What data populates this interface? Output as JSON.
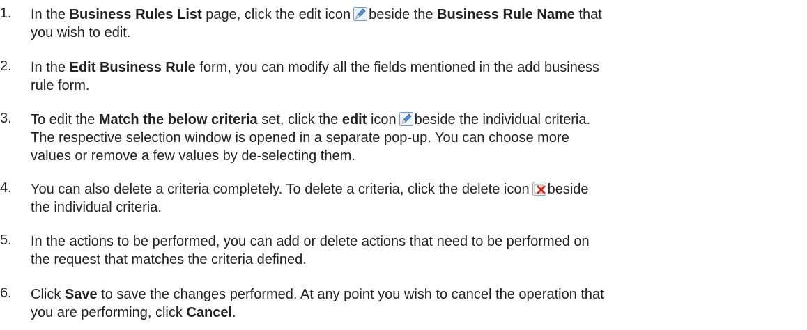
{
  "steps": [
    {
      "number": "1.",
      "l1_a": "In the ",
      "l1_b": "Business Rules List",
      "l1_c": " page, click the edit icon",
      "l1_d": "beside the ",
      "l1_e": "Business Rule Name",
      "l1_f": " that",
      "l2": "you wish to edit."
    },
    {
      "number": "2.",
      "l1_a": "In the ",
      "l1_b": "Edit Business Rule",
      "l1_c": " form, you can modify all the fields mentioned in the add business",
      "l2": "rule form."
    },
    {
      "number": "3.",
      "l1_a": "To edit the ",
      "l1_b": "Match the below criteria",
      "l1_c": " set, click the ",
      "l1_d": "edit",
      "l1_e": " icon",
      "l1_f": "beside the individual criteria.",
      "l2": "The respective selection window is opened in a separate pop-up. You can choose more",
      "l3": "values or remove a few values by de-selecting them."
    },
    {
      "number": "4.",
      "l1_a": "You can also delete a criteria completely. To delete a criteria, click the delete icon",
      "l1_b": "beside",
      "l2": "the individual criteria."
    },
    {
      "number": "5.",
      "l1": "In the actions to be performed, you can add or delete actions that need to be performed on",
      "l2": "the request that matches the criteria defined."
    },
    {
      "number": "6.",
      "l1_a": "Click ",
      "l1_b": "Save",
      "l1_c": " to save the changes performed. At any point you wish to cancel the operation that",
      "l2_a": "you are performing, click ",
      "l2_b": "Cancel",
      "l2_c": "."
    }
  ],
  "icons": {
    "edit": "edit-icon",
    "delete": "delete-icon"
  }
}
